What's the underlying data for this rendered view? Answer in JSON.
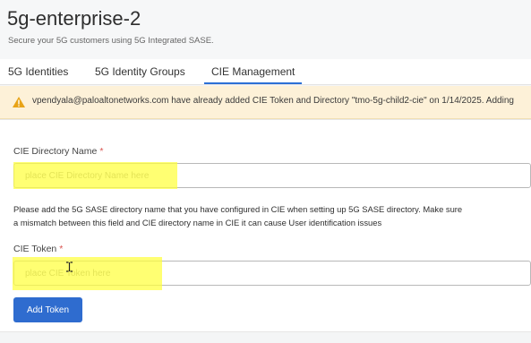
{
  "header": {
    "title": "5g-enterprise-2",
    "subtitle": "Secure your 5G customers using 5G Integrated SASE."
  },
  "tabs": [
    {
      "label": "5G Identities",
      "active": false
    },
    {
      "label": "5G Identity Groups",
      "active": false
    },
    {
      "label": "CIE Management",
      "active": true
    }
  ],
  "alert": {
    "icon": "warning-icon",
    "text": "vpendyala@paloaltonetworks.com have already added CIE Token and Directory \"tmo-5g-child2-cie\" on 1/14/2025. Adding"
  },
  "form": {
    "directory_label": "CIE Directory Name",
    "directory_placeholder": "place CIE Directory Name here",
    "help_line1": "Please add the 5G SASE directory name that you have configured in CIE when setting up 5G SASE directory. Make sure",
    "help_line2": "a mismatch between this field and CIE directory name in CIE it can cause User identification issues",
    "token_label": "CIE Token",
    "token_placeholder": "place CIE Token here",
    "required_mark": "*",
    "add_button": "Add Token"
  },
  "colors": {
    "accent": "#2b6fd6",
    "button": "#2f6ccf",
    "warning_bg": "#fdf1d8",
    "warning_icon": "#e8a317",
    "required": "#d9534f",
    "highlight": "#ffff3c"
  }
}
